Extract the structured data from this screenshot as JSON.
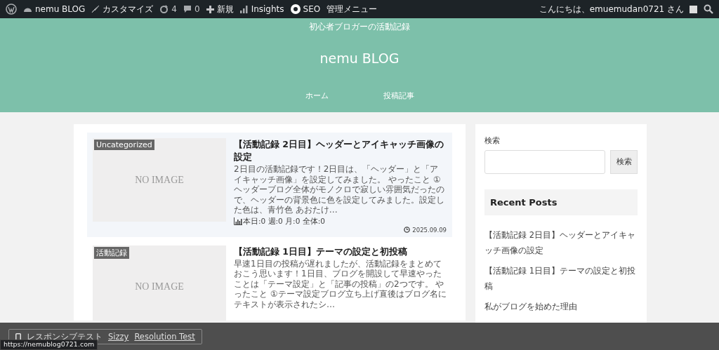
{
  "admin_bar": {
    "items": [
      {
        "kind": "wp"
      },
      {
        "kind": "site",
        "label": "nemu BLOG"
      },
      {
        "kind": "customize",
        "label": "カスタマイズ"
      },
      {
        "kind": "updates",
        "label": "4"
      },
      {
        "kind": "comments",
        "label": "0"
      },
      {
        "kind": "new",
        "label": "新規"
      },
      {
        "kind": "insights",
        "label": "Insights"
      },
      {
        "kind": "seo",
        "label": "SEO"
      },
      {
        "kind": "text",
        "label": "管理メニュー"
      }
    ],
    "greeting": "こんにちは、emuemudan0721 さん"
  },
  "header": {
    "tagline": "初心者ブロガーの活動記録",
    "title": "nemu BLOG",
    "nav": [
      "ホーム",
      "投稿記事"
    ]
  },
  "posts": [
    {
      "highlighted": true,
      "category": "Uncategorized",
      "thumbnail": "NO IMAGE",
      "title": "【活動記録 2日目】ヘッダーとアイキャッチ画像の設定",
      "excerpt": "2日目の活動記録です！2日目は、「ヘッダー」と「アイキャッチ画像」を設定してみました。 やったこと ①ヘッダーブログ全体がモノクロで寂しい雰囲気だったので、ヘッダーの背景色に色を設定してみました。設定した色は、青竹色 あおたけ…",
      "stats": "本日:0 週:0 月:0 全体:0",
      "date": "2025.09.09"
    },
    {
      "highlighted": false,
      "category": "活動記録",
      "thumbnail": "NO IMAGE",
      "title": "【活動記録 1日目】テーマの設定と初投稿",
      "excerpt": "早速1日目の投稿が遅れましたが、活動記録をまとめておこう思います！1日目、ブログを開設して早速やったことは「テーマ設定」と「記事の投稿」の2つです。 やったこと ①テーマ設定ブログ立ち上げ直後はブログ名にテキストが表示されたシ…"
    }
  ],
  "sidebar": {
    "search_label": "検索",
    "search_button": "検索",
    "recent_heading": "Recent Posts",
    "recent": [
      "【活動記録 2日目】ヘッダーとアイキャッチ画像の設定",
      "【活動記録 1日目】テーマの設定と初投稿",
      "私がブログを始めた理由"
    ]
  },
  "overlay": {
    "label": "レスポンシブテスト",
    "links": [
      "Sizzy",
      "Resolution Test"
    ]
  },
  "status_url": "https://nemublog0721.com"
}
